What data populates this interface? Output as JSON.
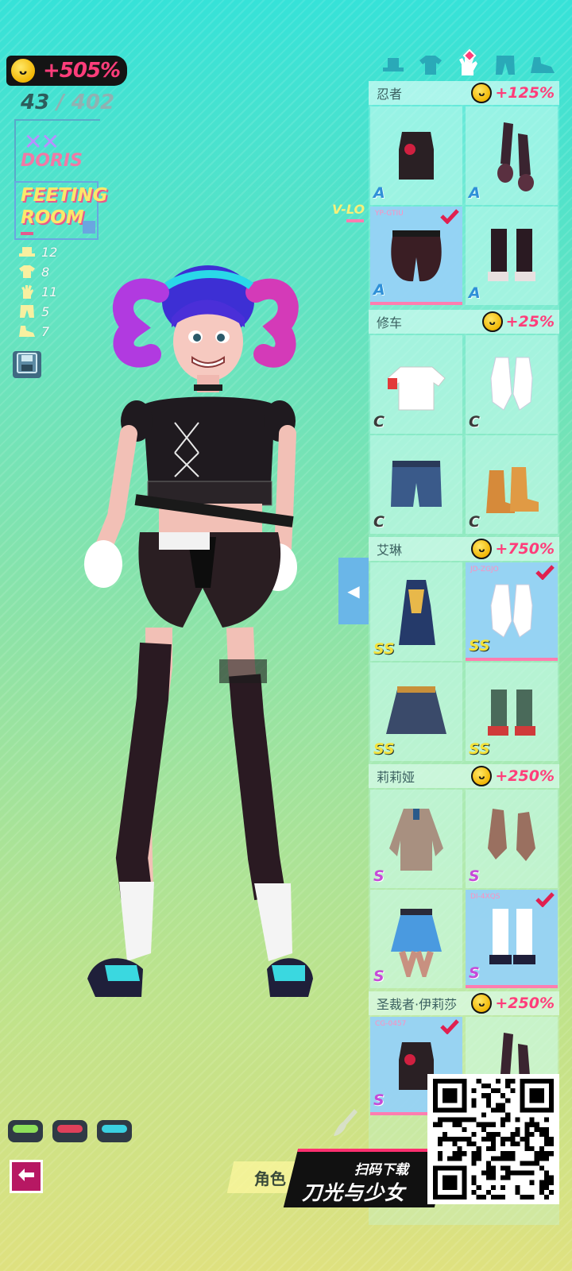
{
  "hud": {
    "bonus": "+505%",
    "collected": "43",
    "separator": " / ",
    "total": "402",
    "player_mark": "✕✕",
    "player_name": "DORIS",
    "room_title_line1": "FEETING",
    "room_title_line2": "ROOM"
  },
  "categories": [
    {
      "icon": "hat-icon",
      "count": "12"
    },
    {
      "icon": "shirt-icon",
      "count": "8"
    },
    {
      "icon": "glove-icon",
      "count": "11"
    },
    {
      "icon": "pants-icon",
      "count": "5"
    },
    {
      "icon": "shoe-icon",
      "count": "7"
    }
  ],
  "slot_tabs": [
    {
      "icon": "hat-icon",
      "active": false
    },
    {
      "icon": "shirt-icon",
      "active": false
    },
    {
      "icon": "glove-icon",
      "active": true
    },
    {
      "icon": "pants-icon",
      "active": false
    },
    {
      "icon": "shoe-icon",
      "active": false
    }
  ],
  "vlo_label": "V-LO",
  "sets": [
    {
      "name": "忍者",
      "bonus": "+125%",
      "items": [
        {
          "rank": "A",
          "code": "",
          "equipped": false,
          "art": "top"
        },
        {
          "rank": "A",
          "code": "",
          "equipped": false,
          "art": "gloves"
        },
        {
          "rank": "A",
          "code": "YP-GTIU",
          "equipped": true,
          "art": "shorts"
        },
        {
          "rank": "A",
          "code": "",
          "equipped": false,
          "art": "boots"
        }
      ]
    },
    {
      "name": "修车",
      "bonus": "+25%",
      "items": [
        {
          "rank": "C",
          "code": "",
          "equipped": false,
          "art": "tee"
        },
        {
          "rank": "C",
          "code": "",
          "equipped": false,
          "art": "gloves-white"
        },
        {
          "rank": "C",
          "code": "",
          "equipped": false,
          "art": "shorts-blue"
        },
        {
          "rank": "C",
          "code": "",
          "equipped": false,
          "art": "boots-brown"
        }
      ]
    },
    {
      "name": "艾琳",
      "bonus": "+750%",
      "items": [
        {
          "rank": "SS",
          "code": "",
          "equipped": false,
          "art": "dress"
        },
        {
          "rank": "SS",
          "code": "JD-ZGJO",
          "equipped": true,
          "art": "gloves-white"
        },
        {
          "rank": "SS",
          "code": "",
          "equipped": false,
          "art": "skirt"
        },
        {
          "rank": "SS",
          "code": "",
          "equipped": false,
          "art": "boots-red"
        }
      ]
    },
    {
      "name": "莉莉娅",
      "bonus": "+250%",
      "items": [
        {
          "rank": "S",
          "code": "",
          "equipped": false,
          "art": "jacket"
        },
        {
          "rank": "S",
          "code": "",
          "equipped": false,
          "art": "gloves-brown"
        },
        {
          "rank": "S",
          "code": "",
          "equipped": false,
          "art": "skirt-blue"
        },
        {
          "rank": "S",
          "code": "DI-4XQS",
          "equipped": true,
          "art": "boots-white"
        }
      ]
    },
    {
      "name": "圣裁者·伊莉莎",
      "bonus": "+250%",
      "items": [
        {
          "rank": "S",
          "code": "CG-0457",
          "equipped": true,
          "art": "top"
        },
        {
          "rank": "",
          "code": "",
          "equipped": false,
          "art": "gloves"
        }
      ]
    }
  ],
  "bottom": {
    "role_tab": "角色",
    "promo_sub": "扫码下载",
    "promo_title": "刀光与少女"
  },
  "colors": {
    "accent_pink": "#ff3d7a",
    "selected_blue": "#96d2f5",
    "rank_yellow": "#f4e23a",
    "back_button": "#b71863"
  }
}
